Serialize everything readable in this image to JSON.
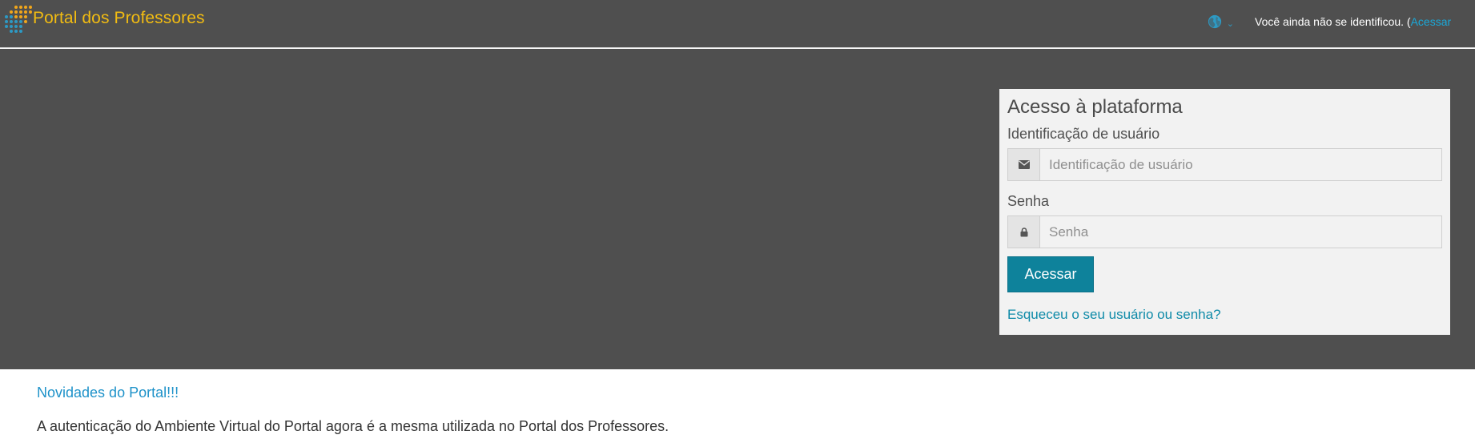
{
  "header": {
    "brand_name": "Portal dos Professores",
    "language_icon": "globe-icon",
    "language_caret": "⌄",
    "login_status": "Você ainda não se identificou. (",
    "login_link": "Acessar",
    "logo_colors": [
      "#f2a71b",
      "#2d9ac4"
    ],
    "brand_color": "#f2bc12",
    "accent": "#0e829b"
  },
  "login": {
    "title": "Acesso à plataforma",
    "username_label": "Identificação de usuário",
    "username_placeholder": "Identificação de usuário",
    "username_icon": "envelope-icon",
    "password_label": "Senha",
    "password_placeholder": "Senha",
    "password_icon": "lock-icon",
    "submit_label": "Acessar",
    "forgot_link": "Esqueceu o seu usuário ou senha?"
  },
  "content": {
    "news_title": "Novidades do Portal!!!",
    "news_text": "A autenticação do Ambiente Virtual do Portal agora é a mesma utilizada no Portal dos Professores."
  }
}
